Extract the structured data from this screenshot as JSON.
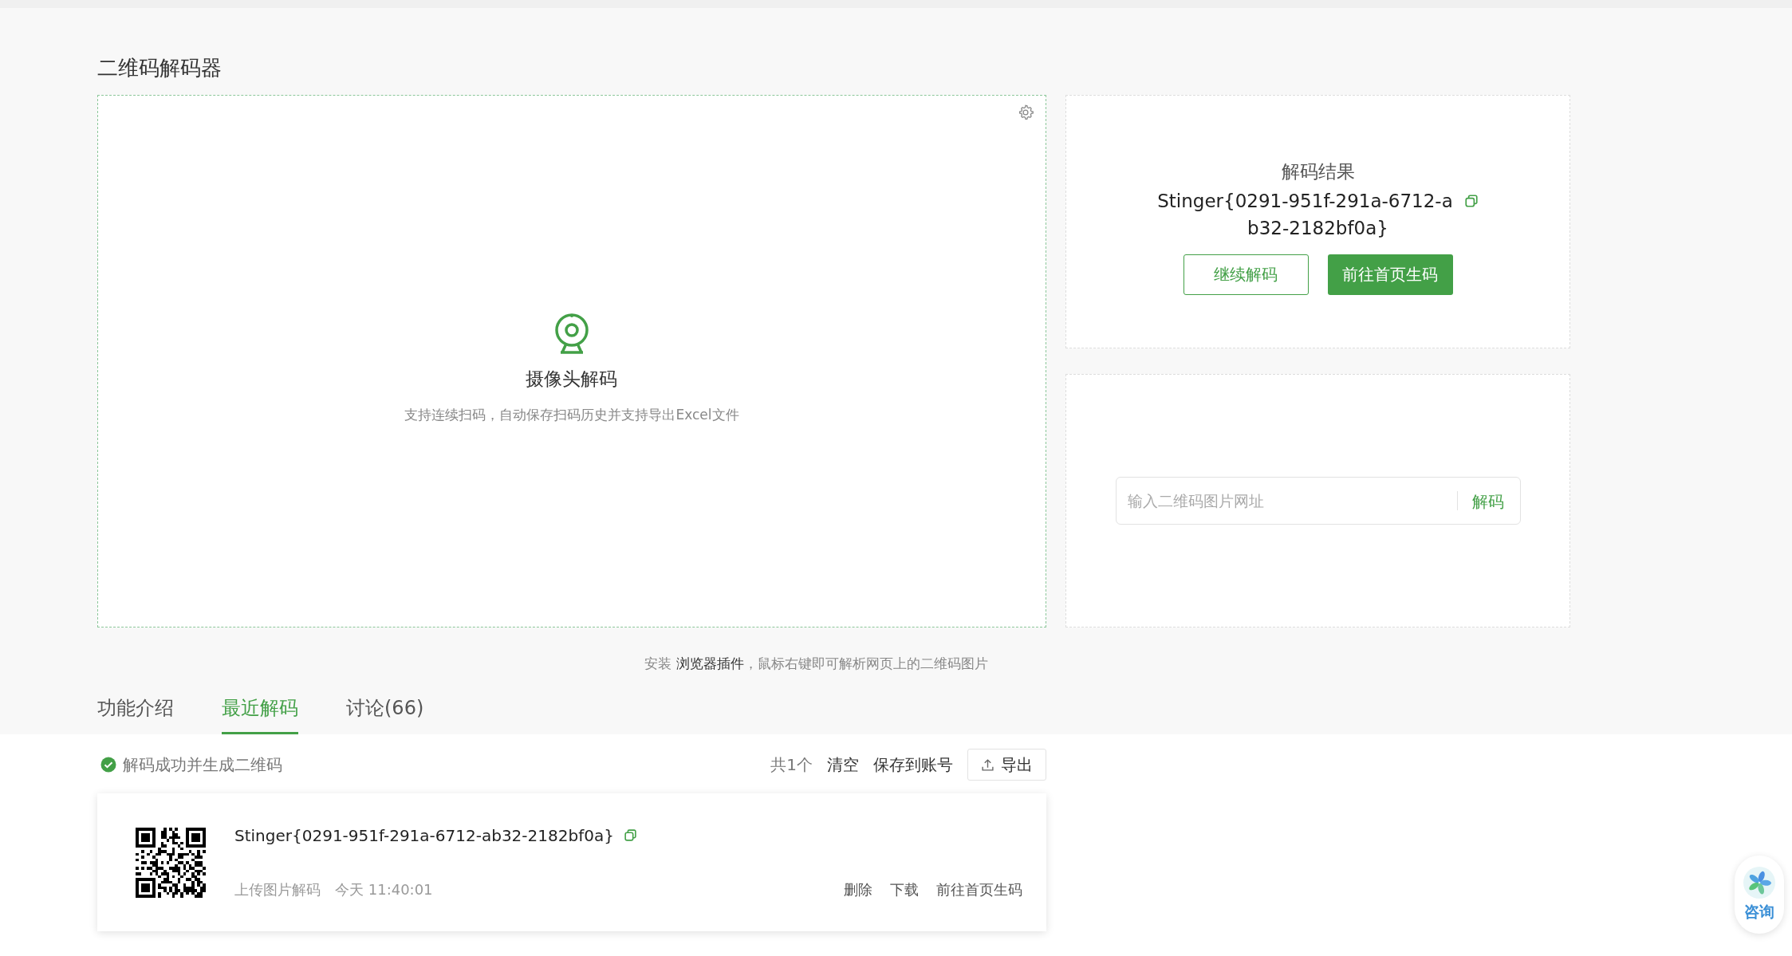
{
  "page_title": "二维码解码器",
  "camera": {
    "title": "摄像头解码",
    "description": "支持连续扫码，自动保存扫码历史并支持导出Excel文件"
  },
  "result": {
    "label": "解码结果",
    "value_line_1": "Stinger{0291-951f-291a-6712-a",
    "value_line_2": "b32-2182bf0a}",
    "buttons": [
      {
        "label": "继续解码",
        "kind": "outline"
      },
      {
        "label": "前往首页生码",
        "kind": "primary"
      }
    ]
  },
  "url_decode": {
    "placeholder": "输入二维码图片网址",
    "button": "解码"
  },
  "hint": {
    "prefix": "安装",
    "link": "浏览器插件",
    "suffix": "，鼠标右键即可解析网页上的二维码图片"
  },
  "tabs": [
    {
      "label": "功能介绍",
      "selected": false
    },
    {
      "label": "最近解码",
      "selected": true
    },
    {
      "label": "讨论(66)",
      "selected": false
    }
  ],
  "history": {
    "status": "解码成功并生成二维码",
    "count": "共1个",
    "actions": [
      "清空",
      "保存到账号"
    ],
    "export": "导出",
    "items": [
      {
        "value": "Stinger{0291-951f-291a-6712-ab32-2182bf0a}",
        "source": "上传图片解码",
        "time": "今天 11:40:01",
        "actions": [
          "删除",
          "下载",
          "前往首页生码"
        ]
      }
    ]
  },
  "consult": "咨询"
}
